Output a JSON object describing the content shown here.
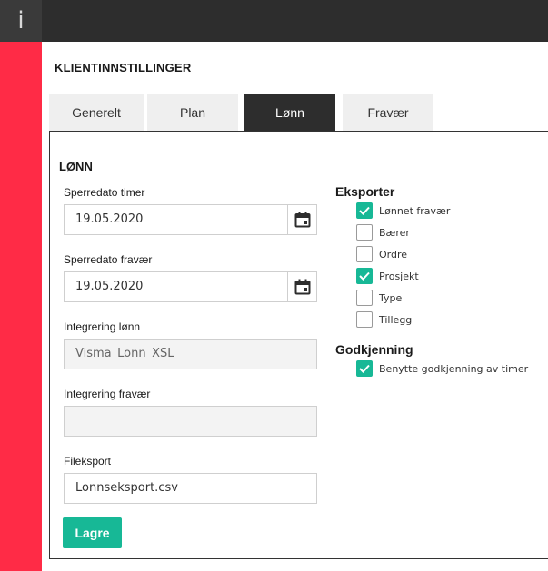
{
  "app": {
    "icon_glyph": "i",
    "icon_name": "info-icon",
    "accent": "#ff2b46",
    "primary": "#17b896"
  },
  "page": {
    "title": "KLIENTINNSTILLINGER"
  },
  "tabs": [
    {
      "label": "Generelt",
      "active": false
    },
    {
      "label": "Plan",
      "active": false
    },
    {
      "label": "Lønn",
      "active": true
    },
    {
      "label": "Fravær",
      "active": false
    }
  ],
  "section": {
    "title": "LØNN"
  },
  "fields": {
    "sperredato_timer": {
      "label": "Sperredato timer",
      "value": "19.05.2020",
      "icon": "calendar-icon"
    },
    "sperredato_fravaer": {
      "label": "Sperredato fravær",
      "value": "19.05.2020",
      "icon": "calendar-icon"
    },
    "integrering_lonn": {
      "label": "Integrering lønn",
      "value": "Visma_Lonn_XSL"
    },
    "integrering_fravaer": {
      "label": "Integrering fravær",
      "value": ""
    },
    "fileksport": {
      "label": "Fileksport",
      "value": "Lonnseksport.csv"
    }
  },
  "eksporter": {
    "title": "Eksporter",
    "items": [
      {
        "label": "Lønnet fravær",
        "checked": true
      },
      {
        "label": "Bærer",
        "checked": false
      },
      {
        "label": "Ordre",
        "checked": false
      },
      {
        "label": "Prosjekt",
        "checked": true
      },
      {
        "label": "Type",
        "checked": false
      },
      {
        "label": "Tillegg",
        "checked": false
      }
    ]
  },
  "godkjenning": {
    "title": "Godkjenning",
    "items": [
      {
        "label": "Benytte godkjenning av timer",
        "checked": true
      }
    ]
  },
  "actions": {
    "save_label": "Lagre"
  }
}
